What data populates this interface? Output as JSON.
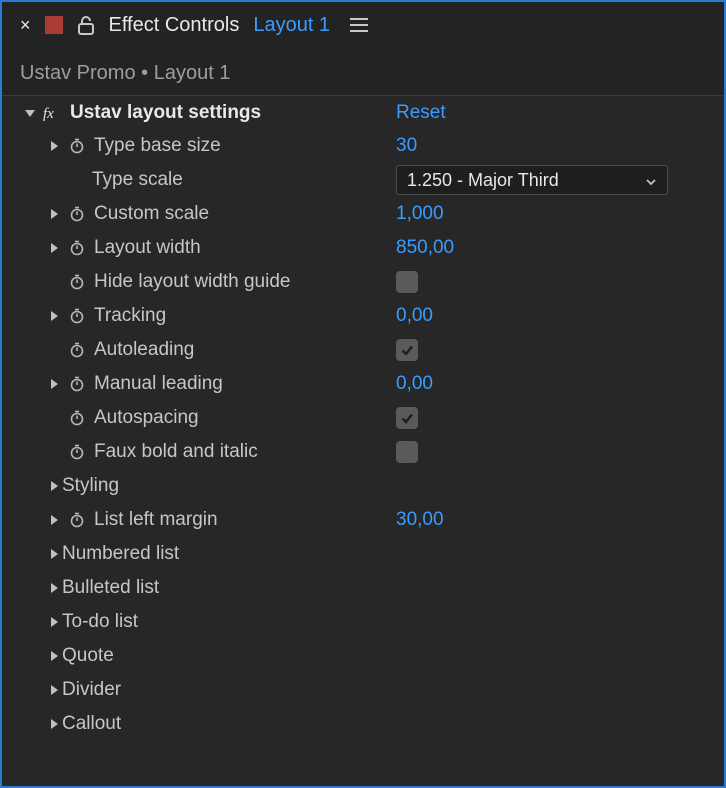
{
  "tabbar": {
    "close": "×",
    "lock_icon": "lock-open-icon",
    "title": "Effect Controls",
    "layer": "Layout 1",
    "menu_icon": "hamburger-icon"
  },
  "breadcrumb": "Ustav Promo • Layout 1",
  "effect": {
    "name": "Ustav layout settings",
    "reset": "Reset"
  },
  "props": {
    "type_base_size": {
      "label": "Type base size",
      "value": "30"
    },
    "type_scale": {
      "label": "Type scale",
      "selected": "1.250 - Major Third"
    },
    "custom_scale": {
      "label": "Custom scale",
      "value": "1,000"
    },
    "layout_width": {
      "label": "Layout width",
      "value": "850,00"
    },
    "hide_guide": {
      "label": "Hide layout width guide",
      "checked": false
    },
    "tracking": {
      "label": "Tracking",
      "value": "0,00"
    },
    "autoleading": {
      "label": "Autoleading",
      "checked": true
    },
    "manual_leading": {
      "label": "Manual leading",
      "value": "0,00"
    },
    "autospacing": {
      "label": "Autospacing",
      "checked": true
    },
    "faux_bold": {
      "label": "Faux bold and italic",
      "checked": false
    },
    "styling": {
      "label": "Styling"
    },
    "list_left_margin": {
      "label": "List left margin",
      "value": "30,00"
    },
    "numbered_list": {
      "label": "Numbered list"
    },
    "bulleted_list": {
      "label": "Bulleted list"
    },
    "todo_list": {
      "label": "To-do list"
    },
    "quote": {
      "label": "Quote"
    },
    "divider": {
      "label": "Divider"
    },
    "callout": {
      "label": "Callout"
    }
  }
}
